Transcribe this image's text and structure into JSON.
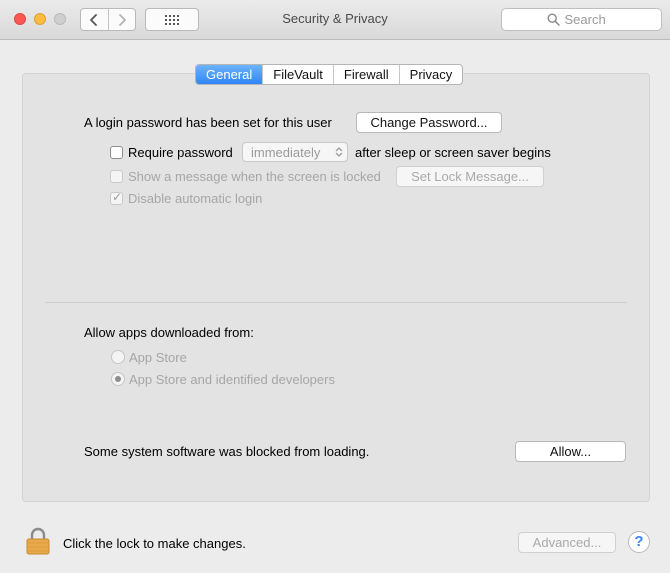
{
  "window": {
    "title": "Security & Privacy",
    "search_placeholder": "Search"
  },
  "toolbar": {
    "back_icon": "chevron-left-icon",
    "forward_icon": "chevron-right-icon",
    "show_all_icon": "grid-icon",
    "search_icon": "magnifier-icon"
  },
  "tabs": [
    {
      "label": "General",
      "active": true
    },
    {
      "label": "FileVault",
      "active": false
    },
    {
      "label": "Firewall",
      "active": false
    },
    {
      "label": "Privacy",
      "active": false
    }
  ],
  "general": {
    "login_password_text": "A login password has been set for this user",
    "change_password_label": "Change Password...",
    "require_password_label": "Require password",
    "require_password_checked": false,
    "require_password_delay": "immediately",
    "require_password_suffix": "after sleep or screen saver begins",
    "show_message_label": "Show a message when the screen is locked",
    "show_message_checked": false,
    "set_lock_message_label": "Set Lock Message...",
    "disable_auto_login_label": "Disable automatic login",
    "disable_auto_login_checked": true
  },
  "downloads": {
    "heading": "Allow apps downloaded from:",
    "options": [
      {
        "label": "App Store",
        "selected": false
      },
      {
        "label": "App Store and identified developers",
        "selected": true
      }
    ]
  },
  "blocked": {
    "text": "Some system software was blocked from loading.",
    "allow_label": "Allow..."
  },
  "footer": {
    "lock_text": "Click the lock to make changes.",
    "advanced_label": "Advanced...",
    "help_label": "?"
  },
  "colors": {
    "accent": "#2f86f6",
    "lock_body": "#e9a94a",
    "disabled_text": "#a6a6a6"
  }
}
